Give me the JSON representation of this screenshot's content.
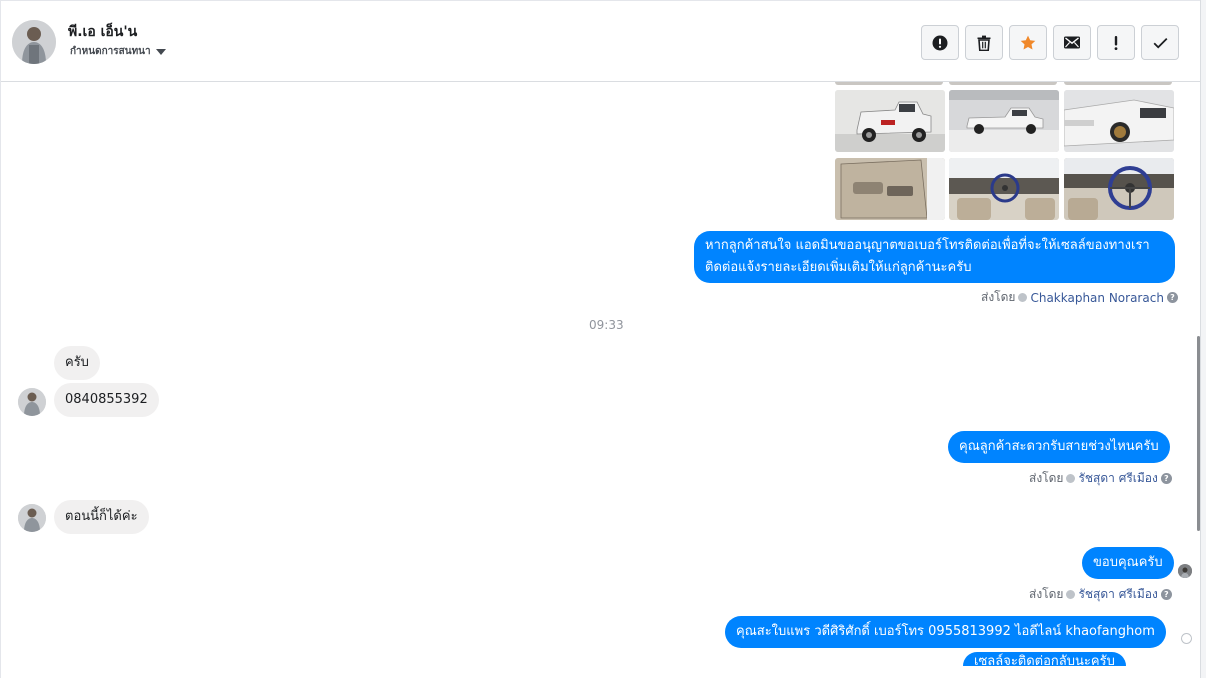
{
  "header": {
    "contact_name": "พี.เอ เอ็น'น",
    "assign_label": "กำหนดการสนทนา"
  },
  "actions": [
    {
      "name": "spam-button",
      "icon": "alert-circle-icon"
    },
    {
      "name": "delete-button",
      "icon": "trash-icon"
    },
    {
      "name": "star-button",
      "icon": "star-icon"
    },
    {
      "name": "mark-unread-button",
      "icon": "envelope-icon"
    },
    {
      "name": "important-button",
      "icon": "exclamation-icon"
    },
    {
      "name": "done-button",
      "icon": "check-icon"
    }
  ],
  "messages": {
    "out1": "หากลูกค้าสนใจ แอดมินขออนุญาตขอเบอร์โทรติดต่อเพื่อที่จะให้เซลล์ของทางเรา",
    "out1b": "ติดต่อแจ้งรายละเอียดเพิ่มเติมให้แก่ลูกค้านะครับ",
    "sentby1_prefix": "ส่งโดย",
    "sentby1_agent": "Chakkaphan Norarach",
    "time": "09:33",
    "in1": "ครับ",
    "in2": "0840855392",
    "out2": "คุณลูกค้าสะดวกรับสายช่วงไหนครับ",
    "sentby2_prefix": "ส่งโดย",
    "sentby2_agent": "รัชสุดา ศรีเมือง",
    "in3": "ตอนนี้ก็ได้ค่ะ",
    "out3": "ขอบคุณครับ",
    "sentby3_prefix": "ส่งโดย",
    "sentby3_agent": "รัชสุดา ศรีเมือง",
    "out4": "คุณสะใบแพร วดีศิริศักดิ์ เบอร์โทร 0955813992 ไอดีไลน์ khaofanghom",
    "out5": "เซลล์จะติดต่อกลับนะครับ"
  },
  "colors": {
    "accent": "#0084ff",
    "star": "#f0882a",
    "incoming_bg": "#f1f0f0"
  }
}
